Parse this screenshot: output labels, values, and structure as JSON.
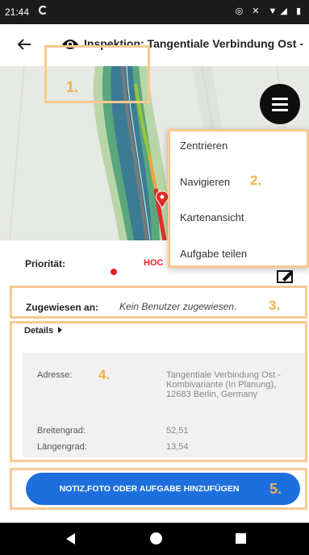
{
  "status_bar": {
    "time": "21:44",
    "icons": "◎ ✕ ▼◢ ▮"
  },
  "header": {
    "title": "Inspektion: Tangentiale Verbindung Ost -"
  },
  "menu": {
    "items": [
      "Zentrieren",
      "Navigieren",
      "Kartenansicht",
      "Aufgabe teilen"
    ]
  },
  "priority": {
    "label": "Priorität:",
    "value": "HOC",
    "color": "#e8202a"
  },
  "assigned": {
    "label": "Zugewiesen an:",
    "value": "Kein Benutzer zugewiesen."
  },
  "details": {
    "header": "Details",
    "address_label": "Adresse:",
    "address_value": "Tangentiale Verbindung Ost - Kombivariante (In Planung), 12683 Berlin, Germany",
    "lat_label": "Breitengrad:",
    "lat_value": "52,51",
    "lng_label": "Längengrad:",
    "lng_value": "13,54"
  },
  "action": {
    "add_label": "NOTIZ,FOTO ODER AUFGABE HINZUFÜGEN"
  },
  "annotations": {
    "n1": "1.",
    "n2": "2.",
    "n3": "3.",
    "n4": "4.",
    "n5": "5."
  },
  "colors": {
    "accent": "#1e6fde",
    "annotation": "#f4b04b",
    "priority": "#e8202a"
  },
  "icons": [
    "back-arrow-icon",
    "eye-icon",
    "menu-icon",
    "edit-icon",
    "location-pin-icon"
  ]
}
